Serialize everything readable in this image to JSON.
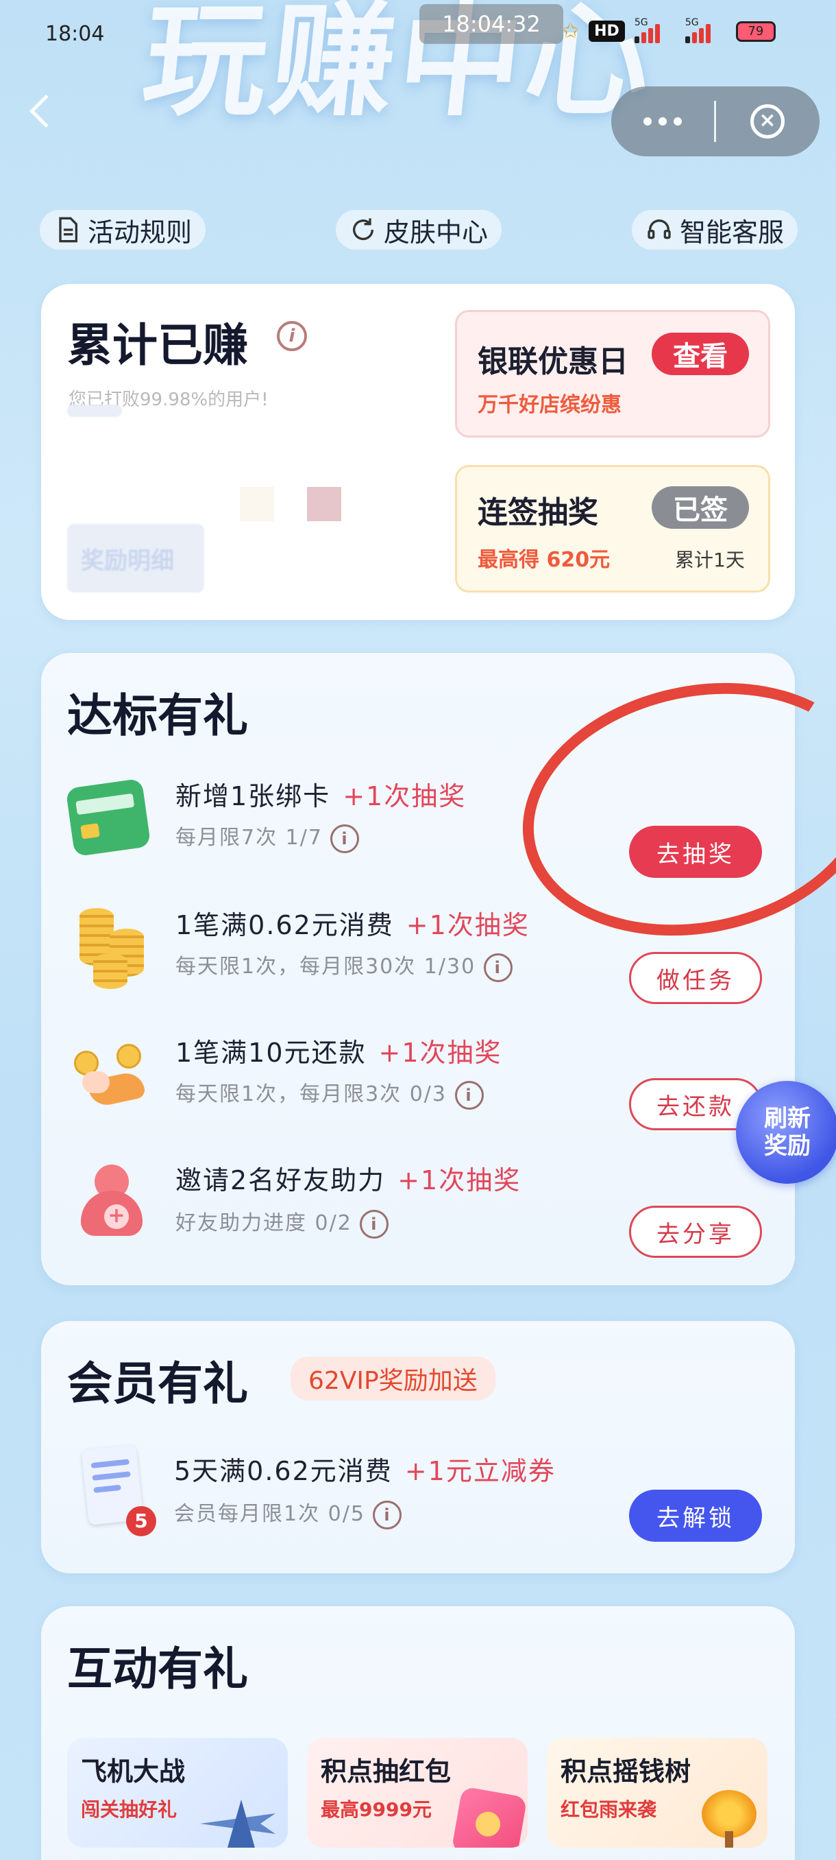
{
  "status_bar": {
    "time": "18:04",
    "overlay_time": "18:04:32",
    "hd": "HD",
    "signal1": "5G",
    "signal2": "5G",
    "battery": "79"
  },
  "banner": {
    "title": "玩赚中心"
  },
  "top_links": [
    {
      "label": "活动规则",
      "icon": "document-icon"
    },
    {
      "label": "皮肤中心",
      "icon": "refresh-icon"
    },
    {
      "label": "智能客服",
      "icon": "headset-icon"
    }
  ],
  "earned_card": {
    "title": "累计已赚",
    "subtitle": "您已打败99.98%的用户!",
    "reward_detail_label": "奖励明细"
  },
  "promo_unionpay": {
    "title": "银联优惠日",
    "subtitle": "万千好店缤纷惠",
    "button": "查看"
  },
  "promo_sign": {
    "title": "连签抽奖",
    "subtitle_prefix": "最高得 ",
    "subtitle_amount": "620元",
    "cumulative": "累计1天",
    "button": "已签"
  },
  "target_section": {
    "title": "达标有礼",
    "tasks": [
      {
        "title": "新增1张绑卡",
        "bonus": "+1次抽奖",
        "sub": "每月限7次 1/7",
        "button": "去抽奖",
        "button_style": "solid"
      },
      {
        "title": "1笔满0.62元消费",
        "bonus": "+1次抽奖",
        "sub": "每天限1次，每月限30次 1/30",
        "button": "做任务",
        "button_style": "outline"
      },
      {
        "title": "1笔满10元还款",
        "bonus": "+1次抽奖",
        "sub": "每天限1次，每月限3次 0/3",
        "button": "去还款",
        "button_style": "outline"
      },
      {
        "title": "邀请2名好友助力",
        "bonus": "+1次抽奖",
        "sub": "好友助力进度 0/2",
        "button": "去分享",
        "button_style": "outline"
      }
    ]
  },
  "refresh_bubble": {
    "line1": "刷新",
    "line2": "奖励"
  },
  "member_section": {
    "title": "会员有礼",
    "vip_chip": "62VIP奖励加送",
    "task": {
      "title": "5天满0.62元消费",
      "bonus": "+1元立减券",
      "sub": "会员每月限1次 0/5",
      "button": "去解锁",
      "badge": "5"
    }
  },
  "interactive_section": {
    "title": "互动有礼",
    "tiles": [
      {
        "title": "飞机大战",
        "sub": "闯关抽好礼"
      },
      {
        "title": "积点抽红包",
        "sub": "最高9999元"
      },
      {
        "title": "积点摇钱树",
        "sub": "红包雨来袭"
      }
    ]
  },
  "colors": {
    "accent_red": "#e6374b",
    "accent_blue": "#4556ee",
    "background": "#c6e4f8"
  }
}
